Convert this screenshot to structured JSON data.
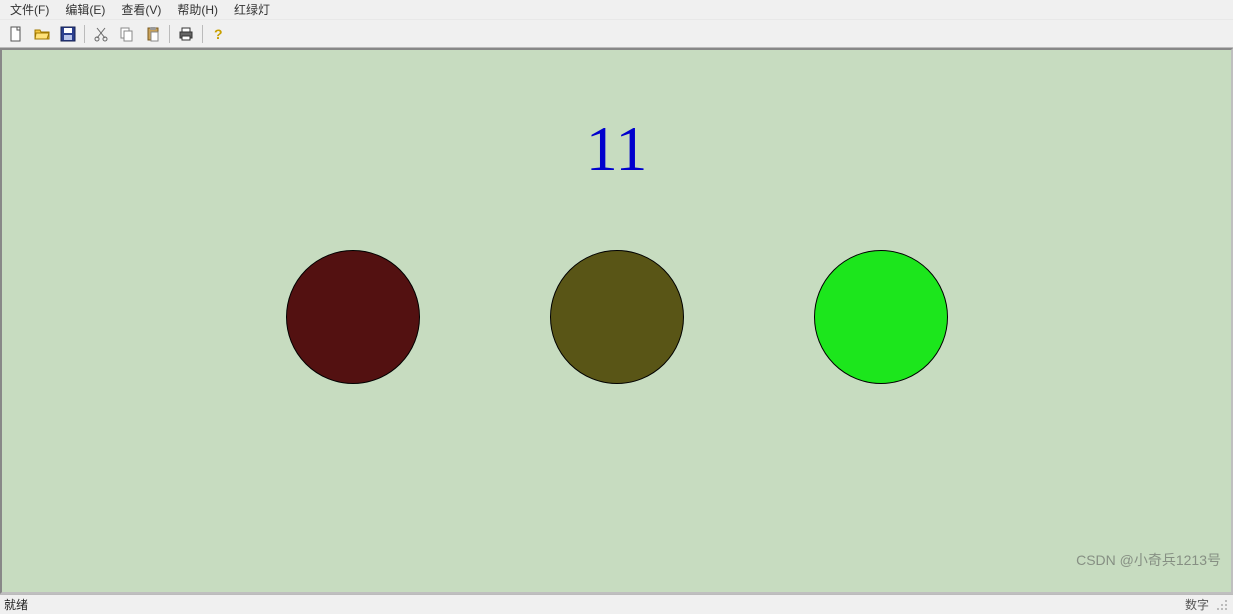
{
  "menu": {
    "file": "文件(F)",
    "edit": "编辑(E)",
    "view": "查看(V)",
    "help": "帮助(H)",
    "traffic": "红绿灯"
  },
  "toolbar": {
    "new": {
      "name": "new-icon"
    },
    "open": {
      "name": "open-icon"
    },
    "save": {
      "name": "save-icon"
    },
    "cut": {
      "name": "cut-icon"
    },
    "copy": {
      "name": "copy-icon"
    },
    "paste": {
      "name": "paste-icon"
    },
    "print": {
      "name": "print-icon"
    },
    "about": {
      "name": "help-icon"
    }
  },
  "timer_value": "11",
  "lights": [
    {
      "name": "red",
      "color": "#531111"
    },
    {
      "name": "yellow",
      "color": "#595516"
    },
    {
      "name": "green",
      "color": "#1ce61c"
    }
  ],
  "status": {
    "ready": "就绪",
    "right": "数字"
  },
  "watermark": "CSDN @小奇兵1213号"
}
